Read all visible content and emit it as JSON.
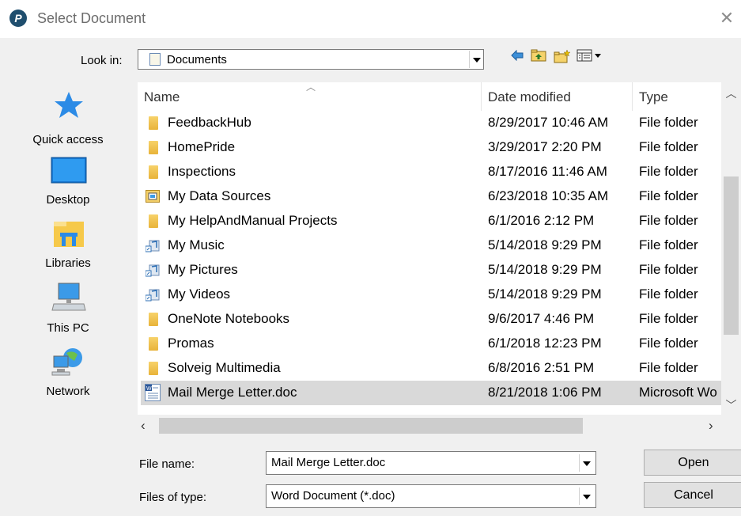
{
  "window": {
    "title": "Select Document",
    "app_icon_letter": "P"
  },
  "toolbar": {
    "lookin_label": "Look in:",
    "lookin_value": "Documents"
  },
  "places": [
    {
      "label": "Quick access",
      "icon": "star-icon"
    },
    {
      "label": "Desktop",
      "icon": "desktop-icon"
    },
    {
      "label": "Libraries",
      "icon": "libraries-icon"
    },
    {
      "label": "This PC",
      "icon": "computer-icon"
    },
    {
      "label": "Network",
      "icon": "network-icon"
    }
  ],
  "columns": {
    "name": "Name",
    "date": "Date modified",
    "type": "Type"
  },
  "files": [
    {
      "name": "FeedbackHub",
      "date": "8/29/2017 10:46 AM",
      "type": "File folder",
      "icon": "folder-icon"
    },
    {
      "name": "HomePride",
      "date": "3/29/2017 2:20 PM",
      "type": "File folder",
      "icon": "folder-icon"
    },
    {
      "name": "Inspections",
      "date": "8/17/2016 11:46 AM",
      "type": "File folder",
      "icon": "folder-icon"
    },
    {
      "name": "My Data Sources",
      "date": "6/23/2018 10:35 AM",
      "type": "File folder",
      "icon": "data-sources-folder-icon"
    },
    {
      "name": "My HelpAndManual Projects",
      "date": "6/1/2016 2:12 PM",
      "type": "File folder",
      "icon": "folder-icon"
    },
    {
      "name": "My Music",
      "date": "5/14/2018 9:29 PM",
      "type": "File folder",
      "icon": "music-shortcut-icon"
    },
    {
      "name": "My Pictures",
      "date": "5/14/2018 9:29 PM",
      "type": "File folder",
      "icon": "pictures-shortcut-icon"
    },
    {
      "name": "My Videos",
      "date": "5/14/2018 9:29 PM",
      "type": "File folder",
      "icon": "videos-shortcut-icon"
    },
    {
      "name": "OneNote Notebooks",
      "date": "9/6/2017 4:46 PM",
      "type": "File folder",
      "icon": "folder-icon"
    },
    {
      "name": "Promas",
      "date": "6/1/2018 12:23 PM",
      "type": "File folder",
      "icon": "folder-icon"
    },
    {
      "name": "Solveig Multimedia",
      "date": "6/8/2016 2:51 PM",
      "type": "File folder",
      "icon": "folder-icon"
    },
    {
      "name": "Mail Merge Letter.doc",
      "date": "8/21/2018 1:06 PM",
      "type": "Microsoft Wo",
      "icon": "word-document-icon",
      "selected": true
    }
  ],
  "footer": {
    "filename_label": "File name:",
    "filename_value": "Mail Merge Letter.doc",
    "filetype_label": "Files of type:",
    "filetype_value": "Word Document (*.doc)",
    "open_label": "Open",
    "cancel_label": "Cancel"
  },
  "colors": {
    "selection": "#d9d9d9",
    "dialog_bg": "#f0f0f0",
    "accent": "#1f4e6e"
  }
}
